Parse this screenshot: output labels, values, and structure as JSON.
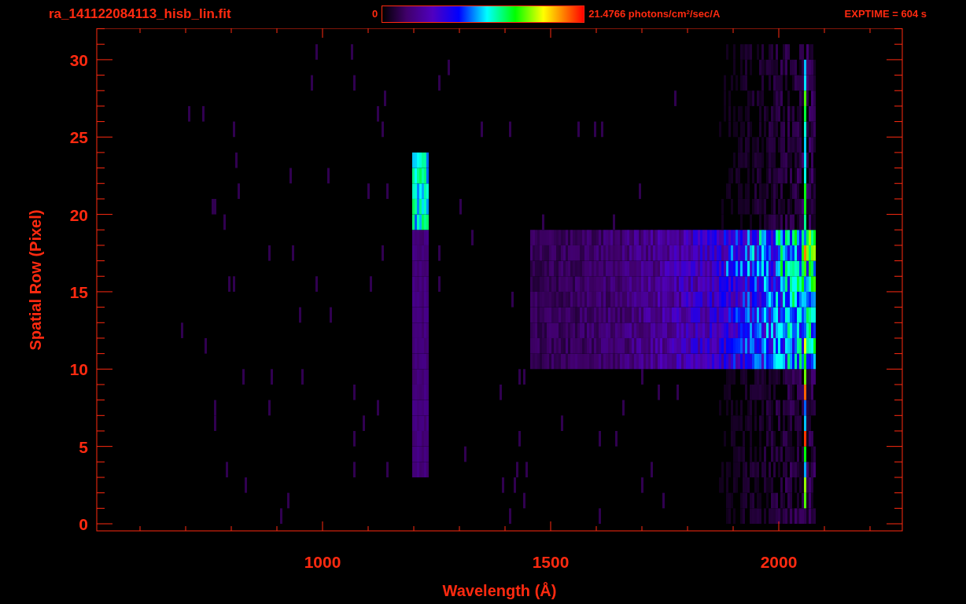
{
  "file_title": "ra_141122084113_hisb_lin.fit",
  "colorbar": {
    "min_label": "0",
    "max_label": "21.4766 photons/cm$^{2}$/sec/A"
  },
  "exposure": "EXPTIME = 604 s",
  "plot": {
    "xlabel": "Wavelength (Å)",
    "ylabel": "Spatial Row (Pixel)",
    "xtick_labels": [
      "1000",
      "1500",
      "2000"
    ],
    "ytick_labels": [
      "30",
      "25",
      "20",
      "15",
      "10",
      "5",
      "0"
    ]
  }
}
